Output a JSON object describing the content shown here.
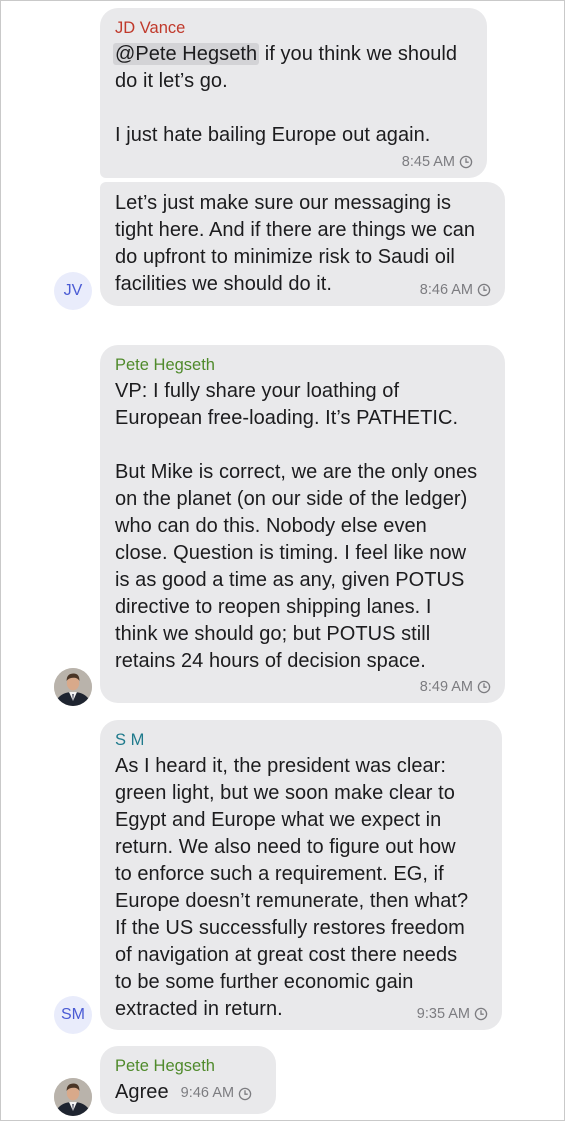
{
  "colors": {
    "jd_vance_name": "#c0392b",
    "pete_hegseth_name": "#4f8a2b",
    "sm_name": "#1f7a8c",
    "bubble": "#e9e9eb",
    "timestamp": "#7c7c80",
    "avatar_initials_bg": "#e9ecfb",
    "avatar_initials_text": "#4a5bd4"
  },
  "messages": [
    {
      "sender": "JD Vance",
      "mention": "@Pete Hegseth",
      "text_after_mention": " if you think we should\ndo it let’s go.\n\nI just hate bailing Europe out again.",
      "time": "8:45 AM"
    },
    {
      "text": "Let’s just make sure our messaging is\ntight here. And if there are things we can\ndo upfront to minimize risk to Saudi oil\nfacilities we should do it.",
      "time": "8:46 AM",
      "avatar": "JV"
    },
    {
      "sender": "Pete Hegseth",
      "text": "VP: I fully share your loathing of\nEuropean free-loading. It’s PATHETIC.\n\nBut Mike is correct, we are the only ones\non the planet (on our side of the ledger)\nwho can do this. Nobody else even\nclose. Question is timing. I feel like now\nis as good a time as any, given POTUS\ndirective to reopen shipping lanes. I\nthink we should go; but POTUS still\nretains 24 hours of decision space.",
      "time": "8:49 AM",
      "avatar": "profile-photo"
    },
    {
      "sender": "S M",
      "text": "As I heard it, the president was clear:\ngreen light, but we soon make clear to\nEgypt and Europe what we expect in\nreturn. We also need to figure out how\nto enforce such a requirement. EG, if\nEurope doesn’t remunerate, then what?\nIf the US successfully restores freedom\nof navigation at great cost there needs\nto be some further economic gain\nextracted in return.",
      "time": "9:35 AM",
      "avatar": "SM"
    },
    {
      "sender": "Pete Hegseth",
      "text": "Agree",
      "time": "9:46 AM",
      "avatar": "profile-photo"
    }
  ]
}
